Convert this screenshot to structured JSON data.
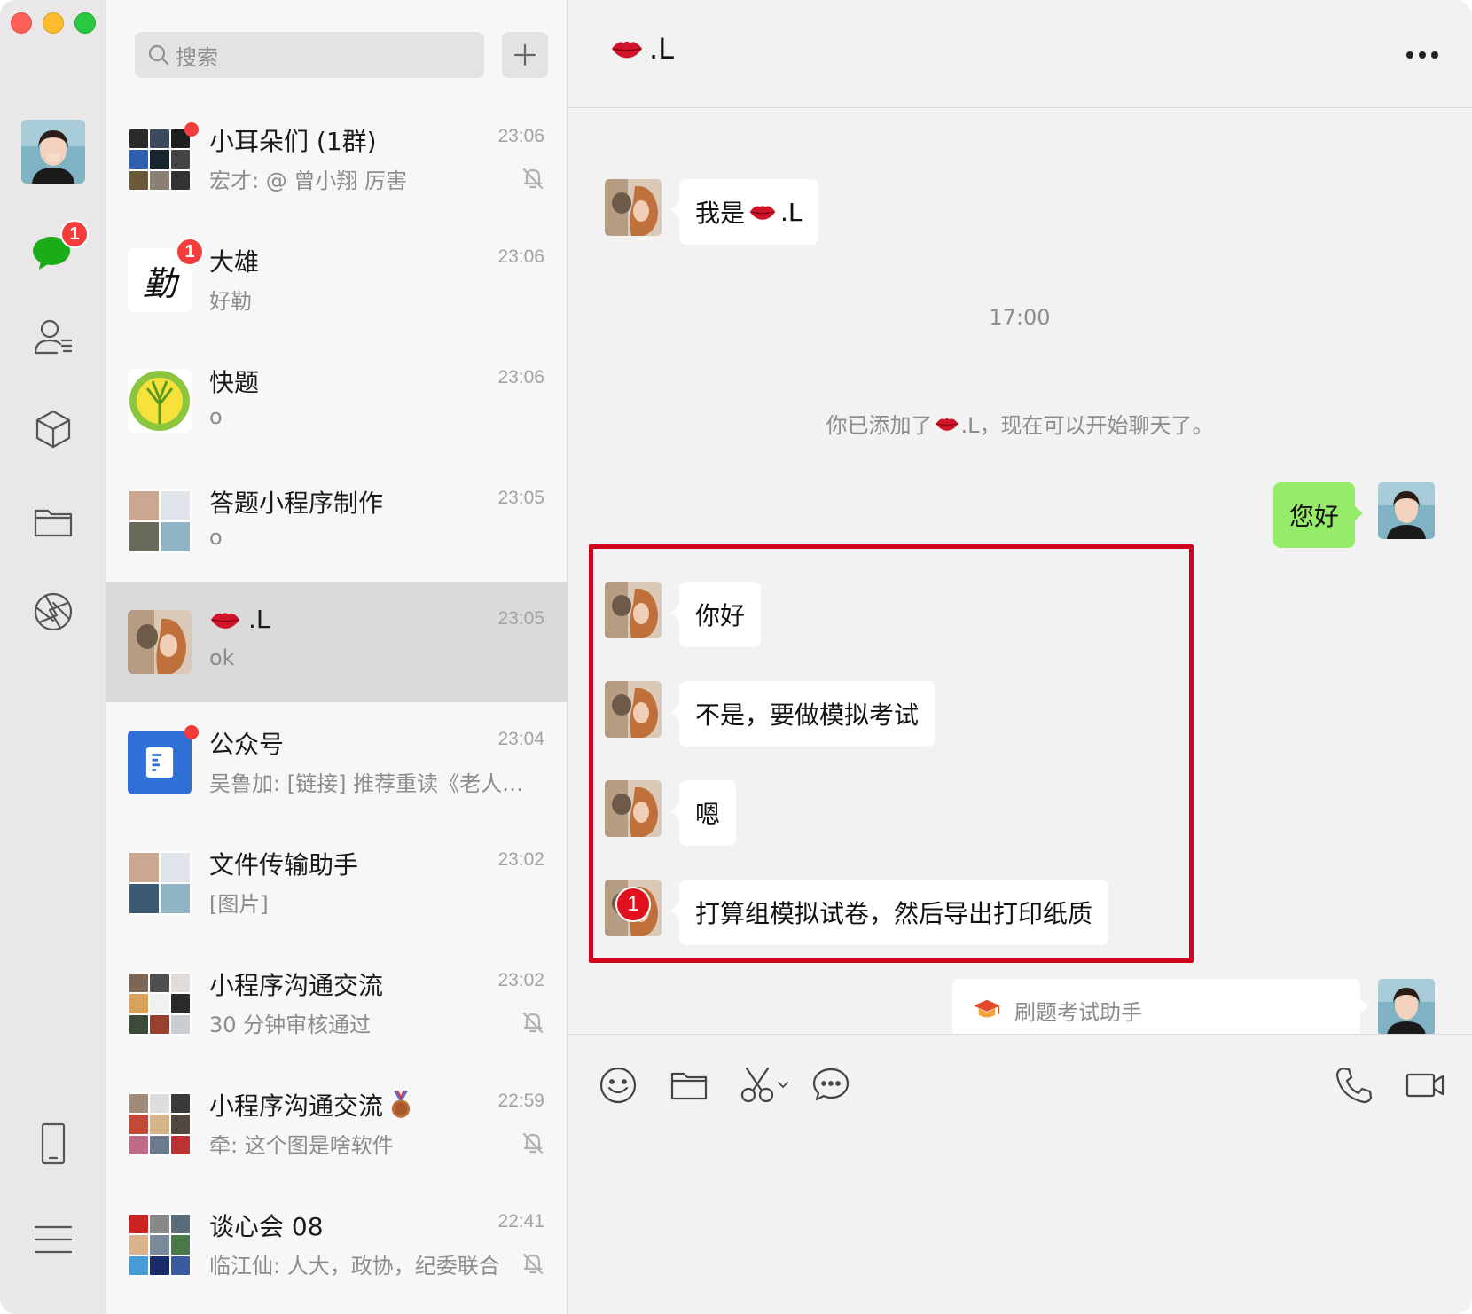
{
  "search": {
    "placeholder": "搜索"
  },
  "nav": {
    "chat_badge": "1"
  },
  "chats": [
    {
      "name": "小耳朵们 (1群)",
      "preview": "宏才: @ 曾小翔 厉害",
      "time": "23:06"
    },
    {
      "name": "大雄",
      "preview": "好勒",
      "time": "23:06",
      "badge": "1",
      "avatar_text": "勤"
    },
    {
      "name": "快题",
      "preview": "o",
      "time": "23:06"
    },
    {
      "name": "答题小程序制作",
      "preview": "o",
      "time": "23:05"
    },
    {
      "name": ".L",
      "preview": "ok",
      "time": "23:05"
    },
    {
      "name": "公众号",
      "preview": "吴鲁加: [链接] 推荐重读《老人…",
      "time": "23:04"
    },
    {
      "name": "文件传输助手",
      "preview": "[图片]",
      "time": "23:02"
    },
    {
      "name": "小程序沟通交流",
      "preview": "30 分钟审核通过",
      "time": "23:02"
    },
    {
      "name": "小程序沟通交流",
      "preview": "牵: 这个图是啥软件",
      "time": "22:59"
    },
    {
      "name": "谈心会 08",
      "preview": "临江仙: 人大，政协，纪委联合",
      "time": "22:41"
    }
  ],
  "conversation": {
    "title": ".L",
    "messages": [
      {
        "text_prefix": "我是",
        "text_suffix": ".L"
      },
      {
        "text": "你好"
      },
      {
        "text": "不是，要做模拟考试"
      },
      {
        "text": "嗯"
      },
      {
        "text": "打算组模拟试卷，然后导出打印纸质",
        "badge": "1"
      }
    ],
    "timestamp": "17:00",
    "system_prefix": "你已添加了",
    "system_suffix": ".L，现在可以开始聊天了。",
    "my_message": "您好",
    "card_title": "刷题考试助手"
  }
}
